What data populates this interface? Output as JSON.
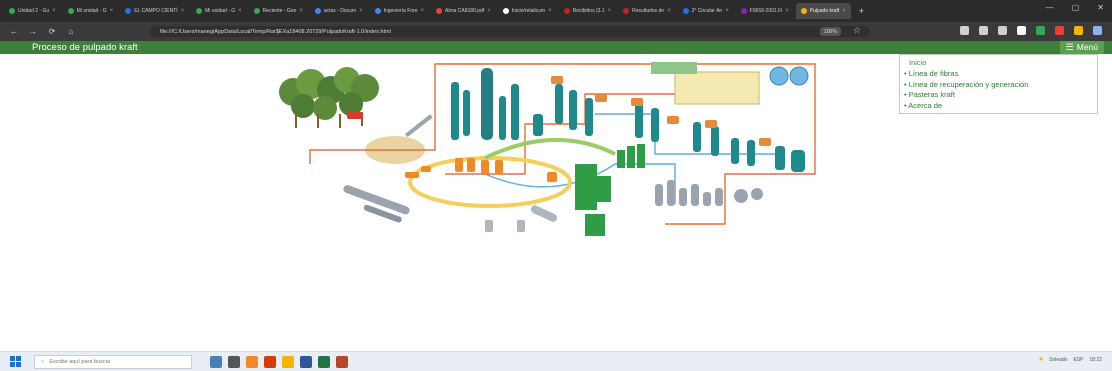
{
  "browser": {
    "tabs": [
      {
        "title": "Unidad 2 - Gu",
        "color": "#3aa757"
      },
      {
        "title": "Mi unidad - G",
        "color": "#3aa757"
      },
      {
        "title": "EL CAMPO CIENTÍ",
        "color": "#1a73e8"
      },
      {
        "title": "Mi unidad - G",
        "color": "#3aa757"
      },
      {
        "title": "Reciente - Goo",
        "color": "#3aa757"
      },
      {
        "title": "actas - Docum",
        "color": "#4285f4"
      },
      {
        "title": "Ingeniería Fore",
        "color": "#4285f4"
      },
      {
        "title": "Alma CA8180.pdf",
        "color": "#e94235"
      },
      {
        "title": "Inicio/retailcum",
        "color": "#ffffff"
      },
      {
        "title": "Recibidos (3.1",
        "color": "#c5221f"
      },
      {
        "title": "Resultados de",
        "color": "#c5221f"
      },
      {
        "title": "2° Circular An",
        "color": "#1a73e8"
      },
      {
        "title": "F0659-2001.Fi",
        "color": "#8e24aa"
      },
      {
        "title": "Pulpado kraft",
        "color": "#f4b400",
        "active": true
      }
    ],
    "new_tab": "+",
    "window_controls": [
      "—",
      "▢",
      "✕"
    ],
    "nav": {
      "back": "←",
      "forward": "→",
      "reload": "⟳",
      "home": "⌂"
    },
    "url": "file:///C:/Users/maneg/AppData/Local/Temp/Rar$EXa18408.20729/PulpadoKraft-1.0/index.html",
    "zoom": "100%",
    "bookmark_star": "☆",
    "extension_colors": [
      "#cfcfcf",
      "#cfcfcf",
      "#cfcfcf",
      "#ffffff",
      "#34a853",
      "#e94235",
      "#f4b400",
      "#8ab4f8"
    ]
  },
  "app": {
    "title": "Proceso de pulpado kraft",
    "menu_label": "Menú",
    "menu_icon": "hamburger-icon",
    "theme_color": "#3f7f3c",
    "accent_color": "#5aa14f",
    "menu_items": [
      "Inicio",
      "• Línea de fibras",
      "• Línea de recuperación y generación",
      "• Pasteras kraft",
      "• Acerca de"
    ]
  },
  "taskbar": {
    "search_placeholder": "Escribe aquí para buscar",
    "tray_text": "Soleado",
    "lang": "ESP",
    "time": "18:22",
    "app_colors": [
      "#4a7fb5",
      "#555555",
      "#f08c28",
      "#d83b01",
      "#f4b400",
      "#2b579a",
      "#217346",
      "#b7472a"
    ]
  }
}
